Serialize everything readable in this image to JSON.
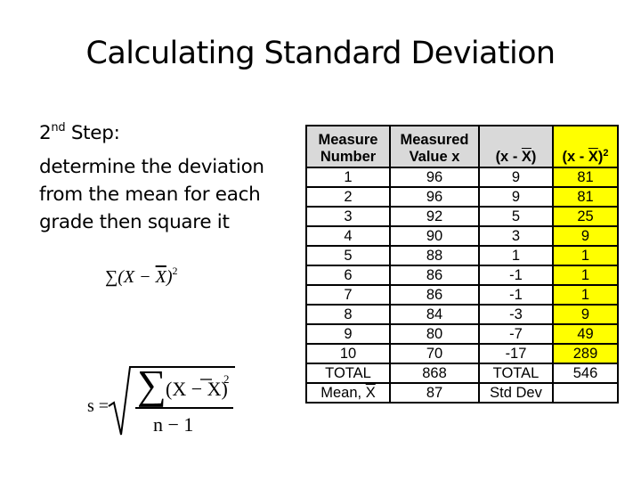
{
  "title": "Calculating Standard Deviation",
  "left_panel": {
    "step_number": "2",
    "step_suffix": "nd",
    "step_label": " Step:",
    "description": "determine the deviation from the mean for each grade then square it",
    "formula_sum_squares": {
      "sigma": "∑",
      "open": "(X − ",
      "xbar": "X",
      "close": ")",
      "exponent": "2"
    },
    "formula_std_dev": {
      "lhs": "s =",
      "numerator": "∑(X − X̄)²",
      "numerator_parts": {
        "sigma": "∑",
        "open": "(X − ",
        "xbar": "X",
        "close": ")",
        "exponent": "2"
      },
      "denominator": "n − 1"
    }
  },
  "table": {
    "headers": [
      {
        "line1": "Measure",
        "line2": "Number"
      },
      {
        "line1": "Measured",
        "line2": "Value x"
      },
      {
        "line1": "",
        "line2_prefix": "(x - ",
        "line2_bar": "X",
        "line2_suffix": ")"
      },
      {
        "line1": "",
        "line2_prefix": "(x - ",
        "line2_bar": "X",
        "line2_suffix": ")",
        "exponent": "2"
      }
    ],
    "rows": [
      [
        "1",
        "96",
        "9",
        "81"
      ],
      [
        "2",
        "96",
        "9",
        "81"
      ],
      [
        "3",
        "92",
        "5",
        "25"
      ],
      [
        "4",
        "90",
        "3",
        "9"
      ],
      [
        "5",
        "88",
        "1",
        "1"
      ],
      [
        "6",
        "86",
        "-1",
        "1"
      ],
      [
        "7",
        "86",
        "-1",
        "1"
      ],
      [
        "8",
        "84",
        "-3",
        "9"
      ],
      [
        "9",
        "80",
        "-7",
        "49"
      ],
      [
        "10",
        "70",
        "-17",
        "289"
      ]
    ],
    "total_row": [
      "TOTAL",
      "868",
      "TOTAL",
      "546"
    ],
    "mean_row": {
      "label_prefix": "Mean, ",
      "label_bar": "X",
      "value": "87",
      "label2": "Std Dev",
      "value2": ""
    },
    "highlight_color": "#ffff00",
    "header_color": "#d9d9d9"
  }
}
